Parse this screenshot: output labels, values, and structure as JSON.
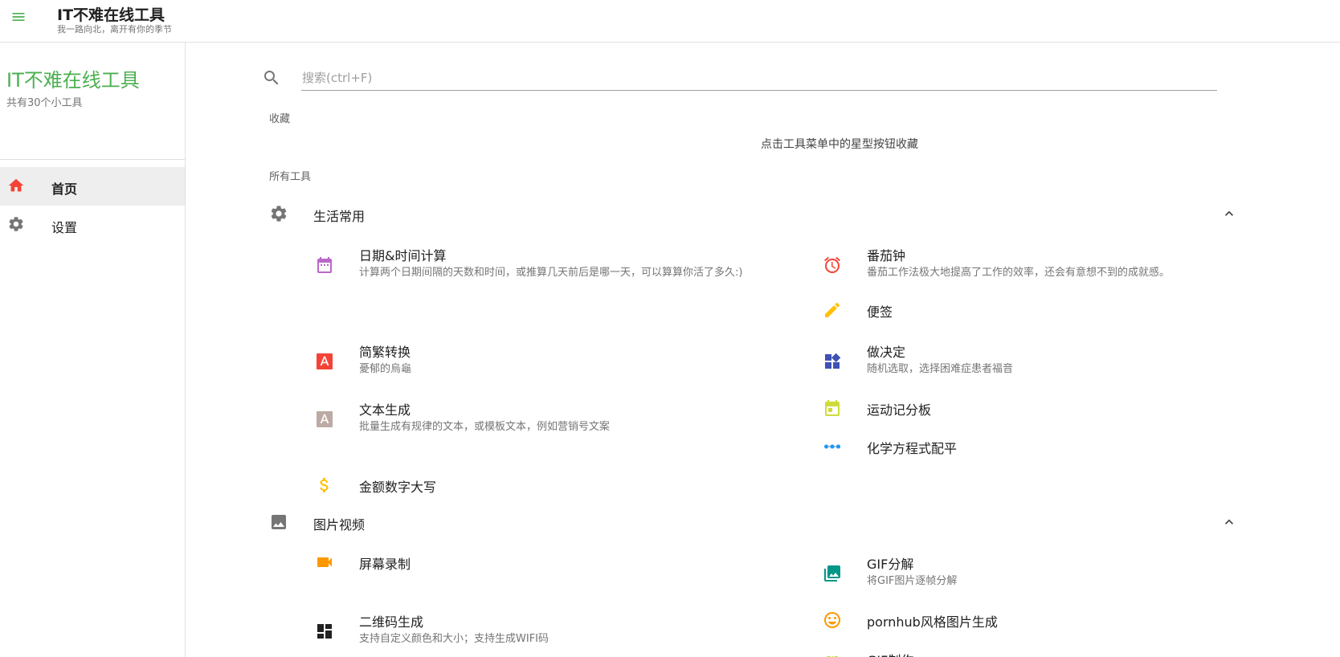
{
  "appbar": {
    "title": "IT不难在线工具",
    "subtitle": "我一路向北，离开有你的季节"
  },
  "sidebar": {
    "brand": "IT不难在线工具",
    "count": "共有30个小工具",
    "items": [
      {
        "label": "首页",
        "icon": "home-icon",
        "active": true
      },
      {
        "label": "设置",
        "icon": "gear-icon",
        "active": false
      }
    ]
  },
  "search": {
    "placeholder": "搜索(ctrl+F)",
    "value": ""
  },
  "favorites": {
    "header": "收藏",
    "empty_text": "点击工具菜单中的星型按钮收藏"
  },
  "all_tools_header": "所有工具",
  "groups": [
    {
      "label": "生活常用",
      "icon": "settings-cog-icon",
      "tools": [
        {
          "title": "日期&时间计算",
          "desc": "计算两个日期间隔的天数和时间，或推算几天前后是哪一天，可以算算你活了多久:)",
          "icon": "calendar-icon",
          "color": "#ba68c8"
        },
        {
          "title": "番茄钟",
          "desc": "番茄工作法极大地提高了工作的效率，还会有意想不到的成就感。",
          "icon": "alarm-clock-icon",
          "color": "#f44336"
        },
        {
          "title": "便签",
          "desc": "",
          "icon": "pencil-icon",
          "color": "#ffc107"
        },
        {
          "title": "简繁转换",
          "desc": "憂郁的烏龜",
          "icon": "font-a-icon",
          "color": "#f44336"
        },
        {
          "title": "做决定",
          "desc": "随机选取，选择困难症患者福音",
          "icon": "widgets-icon",
          "color": "#3f51b5"
        },
        {
          "title": "文本生成",
          "desc": "批量生成有规律的文本，或模板文本，例如营销号文案",
          "icon": "text-a-icon",
          "color": "#bcaaa4"
        },
        {
          "title": "运动记分板",
          "desc": "",
          "icon": "scoreboard-icon",
          "color": "#cddc39"
        },
        {
          "title": "化学方程式配平",
          "desc": "",
          "icon": "linear-scale-icon",
          "color": "#2196f3"
        },
        {
          "title": "金额数字大写",
          "desc": "",
          "icon": "dollar-icon",
          "color": "#ffc107"
        }
      ]
    },
    {
      "label": "图片视频",
      "icon": "image-icon",
      "tools": [
        {
          "title": "屏幕录制",
          "desc": "",
          "icon": "videocam-icon",
          "color": "#ff9800"
        },
        {
          "title": "GIF分解",
          "desc": "将GIF图片逐帧分解",
          "icon": "photo-library-icon",
          "color": "#009688"
        },
        {
          "title": "二维码生成",
          "desc": "支持自定义颜色和大小；支持生成WIFI码",
          "icon": "qr-dashboard-icon",
          "color": "#212121"
        },
        {
          "title": "pornhub风格图片生成",
          "desc": "",
          "icon": "smiley-icon",
          "color": "#ff9800"
        },
        {
          "title": "GIF制作",
          "desc": "",
          "icon": "gif-icon",
          "color": "#cddc39"
        }
      ]
    }
  ]
}
